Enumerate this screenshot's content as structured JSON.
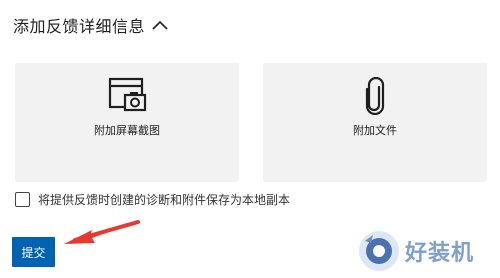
{
  "feedback_details": {
    "title": "添加反馈详细信息",
    "expanded": true
  },
  "attach_screenshot": {
    "label": "附加屏幕截图",
    "icon": "screenshot-icon"
  },
  "attach_file": {
    "label": "附加文件",
    "icon": "paperclip-icon"
  },
  "save_copy": {
    "label": "将提供反馈时创建的诊断和附件保存为本地副本",
    "checked": false
  },
  "submit": {
    "label": "提交"
  },
  "watermark": {
    "text": "好装机"
  },
  "colors": {
    "accent": "#0063b1",
    "tile_bg": "#f2f2f2",
    "arrow": "#e8382f"
  }
}
